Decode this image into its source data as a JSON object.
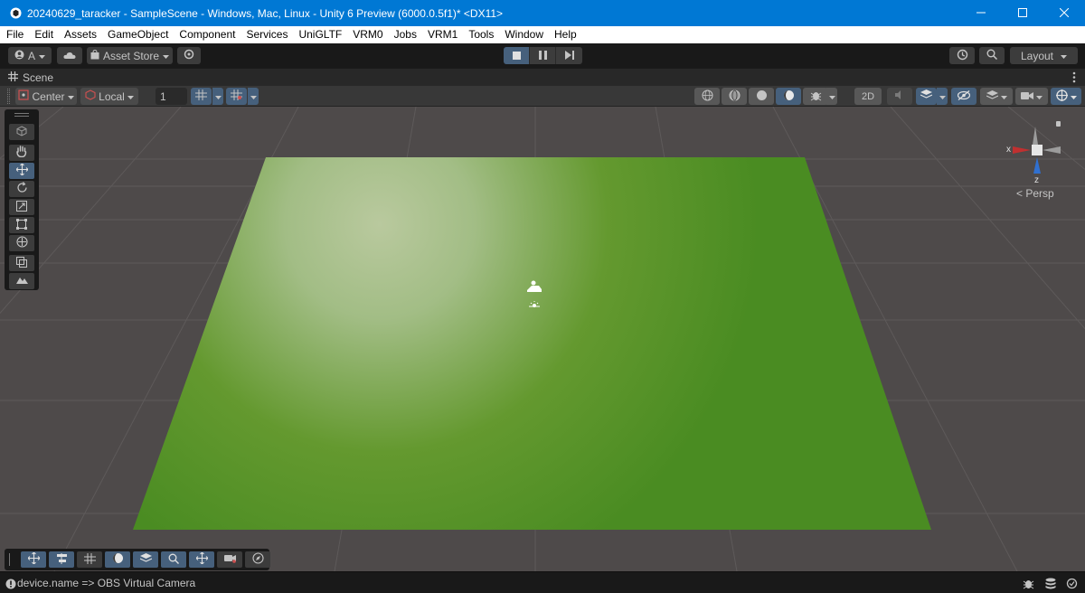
{
  "window": {
    "title": "20240629_taracker - SampleScene - Windows, Mac, Linux - Unity 6 Preview (6000.0.5f1)* <DX11>",
    "controls": [
      "minimize-icon",
      "maximize-icon",
      "close-icon"
    ]
  },
  "menubar": {
    "items": [
      "File",
      "Edit",
      "Assets",
      "GameObject",
      "Component",
      "Services",
      "UniGLTF",
      "VRM0",
      "Jobs",
      "VRM1",
      "Tools",
      "Window",
      "Help"
    ]
  },
  "toolbar": {
    "account_label": "A",
    "asset_store_label": "Asset Store",
    "layout_label": "Layout",
    "play_controls": [
      "stop-icon",
      "pause-icon",
      "step-icon"
    ]
  },
  "scene_tab": {
    "label": "Scene"
  },
  "scene_toolbar": {
    "pivot_label": "Center",
    "space_label": "Local",
    "grid_snap_value": "1",
    "mode_2d_label": "2D"
  },
  "gizmo": {
    "x_label": "x",
    "z_label": "z",
    "projection_label": "< Persp"
  },
  "status": {
    "message": "device.name => OBS Virtual Camera"
  },
  "colors": {
    "title_bar": "#0078d4",
    "scene_background": "#4e4a4a",
    "ground_plane": "#4a8c26",
    "highlight": "#46607c"
  }
}
